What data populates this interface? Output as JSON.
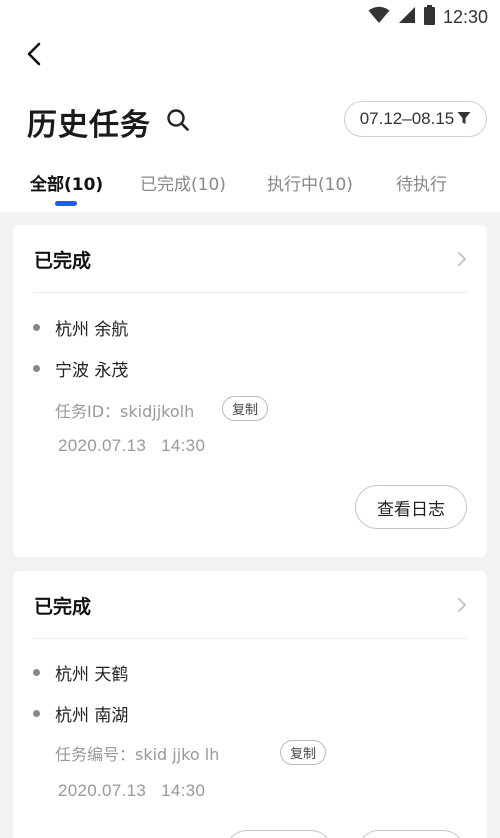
{
  "status_bar": {
    "time": "12:30"
  },
  "header": {
    "title": "历史任务",
    "date_range": "07.12–08.15"
  },
  "tabs": [
    {
      "label": "全部(10)",
      "active": true
    },
    {
      "label": "已完成(10)",
      "active": false
    },
    {
      "label": "执行中(10)",
      "active": false
    },
    {
      "label": "待执行",
      "active": false
    }
  ],
  "cards": [
    {
      "status": "已完成",
      "route": [
        "杭州 余航",
        "宁波 永茂"
      ],
      "task_id": "任务ID：skidjjkolh",
      "copy_label": "复制",
      "time": "2020.07.13   14:30",
      "log_button": "查看日志"
    },
    {
      "status": "已完成",
      "route": [
        "杭州 天鹤",
        "杭州 南湖"
      ],
      "task_id": "任务编号：skid jjko lh",
      "copy_label": "复制",
      "time": "2020.07.13   14:30"
    }
  ],
  "colors": {
    "accent": "#1f5bff",
    "background": "#f2f2f2",
    "card": "#ffffff"
  },
  "icons": [
    "wifi-icon",
    "signal-icon",
    "battery-icon",
    "back-arrow-icon",
    "search-icon",
    "filter-icon",
    "chevron-right-icon"
  ]
}
